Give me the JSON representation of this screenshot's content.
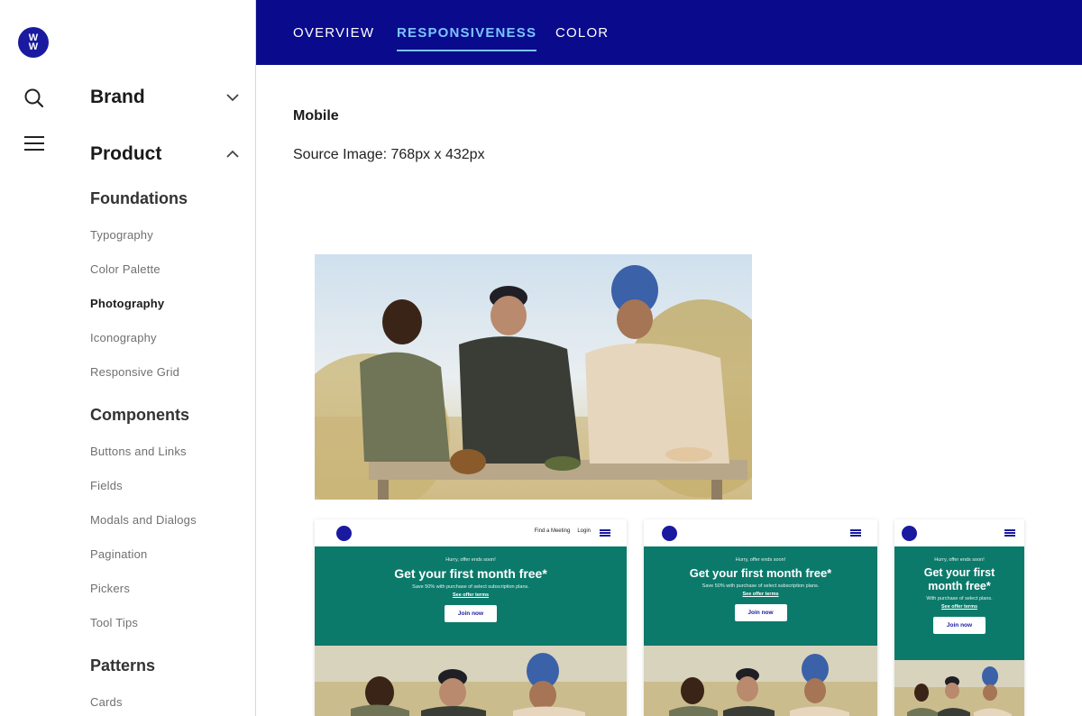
{
  "brand": {
    "logo_text": "WW",
    "primary_color": "#0a0a8c",
    "accent_color": "#7cc4ff",
    "promo_color": "#0c7a6b"
  },
  "rail": {
    "icons": [
      "search-icon",
      "menu-icon"
    ]
  },
  "sidebar": {
    "brand_label": "Brand",
    "product_label": "Product",
    "groups": [
      {
        "title": "Foundations",
        "items": [
          "Typography",
          "Color Palette",
          "Photography",
          "Iconography",
          "Responsive Grid"
        ]
      },
      {
        "title": "Components",
        "items": [
          "Buttons and Links",
          "Fields",
          "Modals and Dialogs",
          "Pagination",
          "Pickers",
          "Tool Tips"
        ]
      },
      {
        "title": "Patterns",
        "items": [
          "Cards"
        ]
      }
    ],
    "active_item": "Photography"
  },
  "tabs": [
    {
      "label": "OVERVIEW"
    },
    {
      "label": "RESPONSIVENESS"
    },
    {
      "label": "COLOR"
    }
  ],
  "active_tab": "RESPONSIVENESS",
  "main": {
    "title": "Mobile",
    "source_image": "Source Image: 768px x 432px"
  },
  "mockups": {
    "find_meeting": "Find a Meeting",
    "login": "Login",
    "eyebrow": "Hurry, offer ends soon!",
    "headline": "Get your first month free*",
    "headline_small_1": "Get your first",
    "headline_small_2": "month free*",
    "fine_print": "Save 50% with purchase of select subscription plans.",
    "fine_print_small": "With purchase of select plans.",
    "terms": "See offer terms",
    "cta": "Join now"
  }
}
